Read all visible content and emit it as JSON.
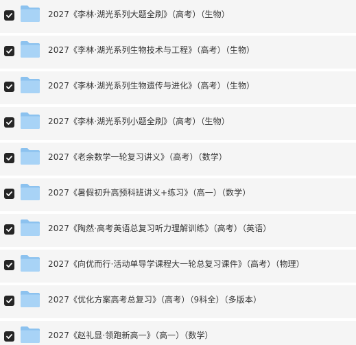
{
  "items": [
    {
      "checked": true,
      "icon": "folder-icon",
      "label": "2027《李林·湖光系列大题全刷》（高考）（生物）"
    },
    {
      "checked": true,
      "icon": "folder-icon",
      "label": "2027《李林·湖光系列生物技术与工程》（高考）（生物）"
    },
    {
      "checked": true,
      "icon": "folder-icon",
      "label": "2027《李林·湖光系列生物遗传与进化》（高考）（生物）"
    },
    {
      "checked": true,
      "icon": "folder-icon",
      "label": "2027《李林·湖光系列小题全刷》（高考）（生物）"
    },
    {
      "checked": true,
      "icon": "folder-icon",
      "label": "2027《老余数学一轮复习讲义》（高考）（数学）"
    },
    {
      "checked": true,
      "icon": "folder-icon",
      "label": "2027《暑假初升高预科班讲义+练习》（高一）（数学）"
    },
    {
      "checked": true,
      "icon": "folder-icon",
      "label": "2027《陶然·高考英语总复习听力理解训练》（高考）（英语）"
    },
    {
      "checked": true,
      "icon": "folder-icon",
      "label": "2027《向优而行·活动单导学课程大一轮总复习课件》（高考）（物理）"
    },
    {
      "checked": true,
      "icon": "folder-icon",
      "label": "2027《优化方案高考总复习》（高考）（9科全）（多版本）"
    },
    {
      "checked": true,
      "icon": "folder-icon",
      "label": "2027《赵礼显·领跑新高一》（高一）（数学）"
    }
  ],
  "colors": {
    "row_bg": "#f5f5f5",
    "checkbox": "#262626",
    "folder_light": "#a8d3f6",
    "folder_dark": "#8cc2ef",
    "text": "#333333"
  }
}
